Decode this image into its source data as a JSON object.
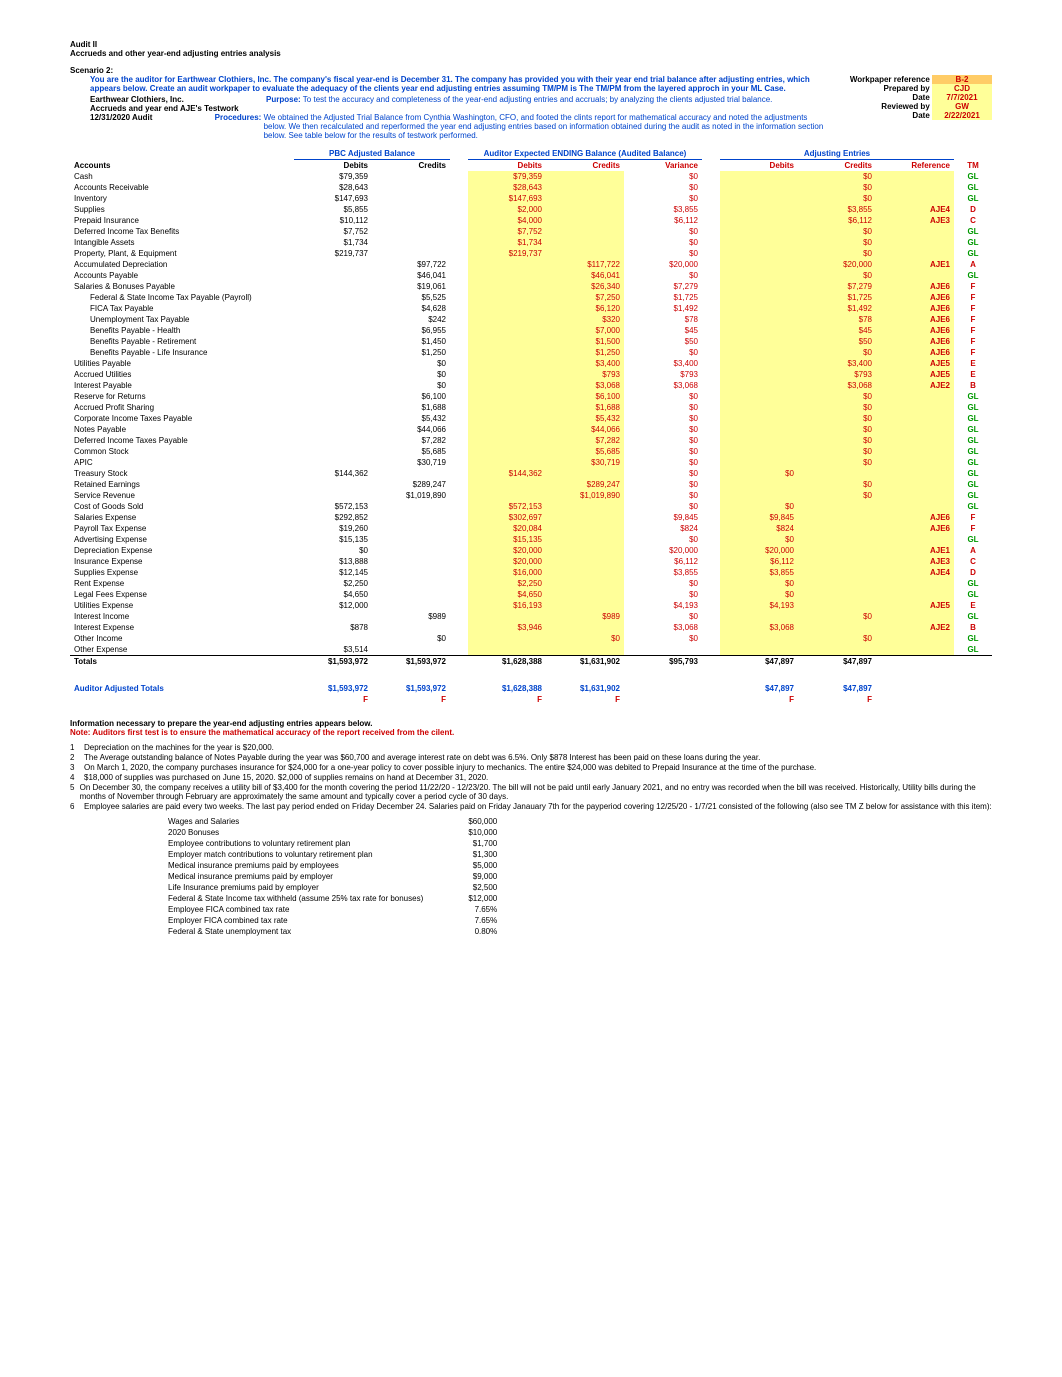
{
  "page_header": {
    "title": "Audit II",
    "subtitle": "Accrueds and other year-end adjusting entries analysis",
    "scenario": "Scenario 2:",
    "instruction": "You are the auditor for Earthwear Clothiers, Inc. The company's fiscal year-end is December 31. The company has provided you with their year end trial balance after adjusting entries, which appears below. Create an audit workpaper to evaluate the adequacy of the clients year end adjusting entries assuming TM/PM is The TM/PM from the layered approch in your ML Case."
  },
  "company": {
    "name": "Earthwear Clothiers, Inc.",
    "line2": "Accrueds and year end AJE's Testwork",
    "line3": "12/31/2020 Audit"
  },
  "purpose_label": "Purpose:",
  "purpose_text": "To test the accuracy and completeness of the year-end adjusting entries and accruals; by analyzing the clients adjusted trial balance.",
  "procedures_label": "Procedures:",
  "procedures_text": "We obtained the Adjusted Trial Balance from Cynthia Washington, CFO, and footed the clints report for mathematical accuracy and noted the adjustments below.   We then recalculated and reperformed the year end adjusting entries based on information obtained during the audit as noted in the information section below.  See table below for the results of testwork performed.",
  "workpaper": {
    "ref_label": "Workpaper reference",
    "ref": "B-2",
    "prep_label": "Prepared by",
    "prep": "CJD",
    "date1_label": "Date",
    "date1": "7/7/2021",
    "rev_label": "Reviewed by",
    "rev": "GW",
    "date2_label": "Date",
    "date2": "2/22/2021"
  },
  "columns": {
    "pbc": "PBC Adjusted Balance",
    "auditor": "Auditor Expected ENDING Balance (Audited Balance)",
    "aje": "Adjusting Entries",
    "accounts": "Accounts",
    "debits": "Debits",
    "credits": "Credits",
    "variance": "Variance",
    "reference": "Reference",
    "tm": "TM"
  },
  "rows": [
    {
      "a": "Cash",
      "pd": "$79,359",
      "pc": "",
      "ad": "$79,359",
      "ac": "",
      "v": "$0",
      "jd": "",
      "jc": "$0",
      "ref": "",
      "tm": "GL"
    },
    {
      "a": "Accounts Receivable",
      "pd": "$28,643",
      "pc": "",
      "ad": "$28,643",
      "ac": "",
      "v": "$0",
      "jd": "",
      "jc": "$0",
      "ref": "",
      "tm": "GL"
    },
    {
      "a": "Inventory",
      "pd": "$147,693",
      "pc": "",
      "ad": "$147,693",
      "ac": "",
      "v": "$0",
      "jd": "",
      "jc": "$0",
      "ref": "",
      "tm": "GL"
    },
    {
      "a": "Supplies",
      "pd": "$5,855",
      "pc": "",
      "ad": "$2,000",
      "ac": "",
      "v": "$3,855",
      "jd": "",
      "jc": "$3,855",
      "ref": "AJE4",
      "tm": "D"
    },
    {
      "a": "Prepaid Insurance",
      "pd": "$10,112",
      "pc": "",
      "ad": "$4,000",
      "ac": "",
      "v": "$6,112",
      "jd": "",
      "jc": "$6,112",
      "ref": "AJE3",
      "tm": "C"
    },
    {
      "a": "Deferred Income Tax Benefits",
      "pd": "$7,752",
      "pc": "",
      "ad": "$7,752",
      "ac": "",
      "v": "$0",
      "jd": "",
      "jc": "$0",
      "ref": "",
      "tm": "GL"
    },
    {
      "a": "Intangible Assets",
      "pd": "$1,734",
      "pc": "",
      "ad": "$1,734",
      "ac": "",
      "v": "$0",
      "jd": "",
      "jc": "$0",
      "ref": "",
      "tm": "GL"
    },
    {
      "a": "Property, Plant, & Equipment",
      "pd": "$219,737",
      "pc": "",
      "ad": "$219,737",
      "ac": "",
      "v": "$0",
      "jd": "",
      "jc": "$0",
      "ref": "",
      "tm": "GL"
    },
    {
      "a": "Accumulated Depreciation",
      "pd": "",
      "pc": "$97,722",
      "ad": "",
      "ac": "$117,722",
      "v": "$20,000",
      "jd": "",
      "jc": "$20,000",
      "ref": "AJE1",
      "tm": "A"
    },
    {
      "a": "Accounts Payable",
      "pd": "",
      "pc": "$46,041",
      "ad": "",
      "ac": "$46,041",
      "v": "$0",
      "jd": "",
      "jc": "$0",
      "ref": "",
      "tm": "GL"
    },
    {
      "a": "Salaries & Bonuses Payable",
      "pd": "",
      "pc": "$19,061",
      "ad": "",
      "ac": "$26,340",
      "v": "$7,279",
      "jd": "",
      "jc": "$7,279",
      "ref": "AJE6",
      "tm": "F"
    },
    {
      "a": "Federal & State Income Tax Payable (Payroll)",
      "pd": "",
      "pc": "$5,525",
      "ad": "",
      "ac": "$7,250",
      "v": "$1,725",
      "jd": "",
      "jc": "$1,725",
      "ref": "AJE6",
      "tm": "F",
      "indent": true
    },
    {
      "a": "FICA Tax Payable",
      "pd": "",
      "pc": "$4,628",
      "ad": "",
      "ac": "$6,120",
      "v": "$1,492",
      "jd": "",
      "jc": "$1,492",
      "ref": "AJE6",
      "tm": "F",
      "indent": true
    },
    {
      "a": "Unemployment Tax Payable",
      "pd": "",
      "pc": "$242",
      "ad": "",
      "ac": "$320",
      "v": "$78",
      "jd": "",
      "jc": "$78",
      "ref": "AJE6",
      "tm": "F",
      "indent": true
    },
    {
      "a": "Benefits Payable - Health",
      "pd": "",
      "pc": "$6,955",
      "ad": "",
      "ac": "$7,000",
      "v": "$45",
      "jd": "",
      "jc": "$45",
      "ref": "AJE6",
      "tm": "F",
      "indent": true
    },
    {
      "a": "Benefits Payable - Retirement",
      "pd": "",
      "pc": "$1,450",
      "ad": "",
      "ac": "$1,500",
      "v": "$50",
      "jd": "",
      "jc": "$50",
      "ref": "AJE6",
      "tm": "F",
      "indent": true
    },
    {
      "a": "Benefits Payable - Life Insurance",
      "pd": "",
      "pc": "$1,250",
      "ad": "",
      "ac": "$1,250",
      "v": "$0",
      "jd": "",
      "jc": "$0",
      "ref": "AJE6",
      "tm": "F",
      "indent": true
    },
    {
      "a": "Utilities Payable",
      "pd": "",
      "pc": "$0",
      "ad": "",
      "ac": "$3,400",
      "v": "$3,400",
      "jd": "",
      "jc": "$3,400",
      "ref": "AJE5",
      "tm": "E"
    },
    {
      "a": "Accrued Utilities",
      "pd": "",
      "pc": "$0",
      "ad": "",
      "ac": "$793",
      "v": "$793",
      "jd": "",
      "jc": "$793",
      "ref": "AJE5",
      "tm": "E"
    },
    {
      "a": "Interest Payable",
      "pd": "",
      "pc": "$0",
      "ad": "",
      "ac": "$3,068",
      "v": "$3,068",
      "jd": "",
      "jc": "$3,068",
      "ref": "AJE2",
      "tm": "B"
    },
    {
      "a": "Reserve for Returns",
      "pd": "",
      "pc": "$6,100",
      "ad": "",
      "ac": "$6,100",
      "v": "$0",
      "jd": "",
      "jc": "$0",
      "ref": "",
      "tm": "GL"
    },
    {
      "a": "Accrued Profit Sharing",
      "pd": "",
      "pc": "$1,688",
      "ad": "",
      "ac": "$1,688",
      "v": "$0",
      "jd": "",
      "jc": "$0",
      "ref": "",
      "tm": "GL"
    },
    {
      "a": "Corporate Income Taxes Payable",
      "pd": "",
      "pc": "$5,432",
      "ad": "",
      "ac": "$5,432",
      "v": "$0",
      "jd": "",
      "jc": "$0",
      "ref": "",
      "tm": "GL"
    },
    {
      "a": "Notes Payable",
      "pd": "",
      "pc": "$44,066",
      "ad": "",
      "ac": "$44,066",
      "v": "$0",
      "jd": "",
      "jc": "$0",
      "ref": "",
      "tm": "GL"
    },
    {
      "a": "Deferred Income Taxes Payable",
      "pd": "",
      "pc": "$7,282",
      "ad": "",
      "ac": "$7,282",
      "v": "$0",
      "jd": "",
      "jc": "$0",
      "ref": "",
      "tm": "GL"
    },
    {
      "a": "Common Stock",
      "pd": "",
      "pc": "$5,685",
      "ad": "",
      "ac": "$5,685",
      "v": "$0",
      "jd": "",
      "jc": "$0",
      "ref": "",
      "tm": "GL"
    },
    {
      "a": "APIC",
      "pd": "",
      "pc": "$30,719",
      "ad": "",
      "ac": "$30,719",
      "v": "$0",
      "jd": "",
      "jc": "$0",
      "ref": "",
      "tm": "GL"
    },
    {
      "a": "Treasury Stock",
      "pd": "$144,362",
      "pc": "",
      "ad": "$144,362",
      "ac": "",
      "v": "$0",
      "jd": "$0",
      "jc": "",
      "ref": "",
      "tm": "GL"
    },
    {
      "a": "Retained Earnings",
      "pd": "",
      "pc": "$289,247",
      "ad": "",
      "ac": "$289,247",
      "v": "$0",
      "jd": "",
      "jc": "$0",
      "ref": "",
      "tm": "GL"
    },
    {
      "a": "Service Revenue",
      "pd": "",
      "pc": "$1,019,890",
      "ad": "",
      "ac": "$1,019,890",
      "v": "$0",
      "jd": "",
      "jc": "$0",
      "ref": "",
      "tm": "GL"
    },
    {
      "a": "Cost of Goods Sold",
      "pd": "$572,153",
      "pc": "",
      "ad": "$572,153",
      "ac": "",
      "v": "$0",
      "jd": "$0",
      "jc": "",
      "ref": "",
      "tm": "GL"
    },
    {
      "a": "Salaries Expense",
      "pd": "$292,852",
      "pc": "",
      "ad": "$302,697",
      "ac": "",
      "v": "$9,845",
      "jd": "$9,845",
      "jc": "",
      "ref": "AJE6",
      "tm": "F"
    },
    {
      "a": "Payroll Tax Expense",
      "pd": "$19,260",
      "pc": "",
      "ad": "$20,084",
      "ac": "",
      "v": "$824",
      "jd": "$824",
      "jc": "",
      "ref": "AJE6",
      "tm": "F"
    },
    {
      "a": "Advertising Expense",
      "pd": "$15,135",
      "pc": "",
      "ad": "$15,135",
      "ac": "",
      "v": "$0",
      "jd": "$0",
      "jc": "",
      "ref": "",
      "tm": "GL"
    },
    {
      "a": "Depreciation Expense",
      "pd": "$0",
      "pc": "",
      "ad": "$20,000",
      "ac": "",
      "v": "$20,000",
      "jd": "$20,000",
      "jc": "",
      "ref": "AJE1",
      "tm": "A"
    },
    {
      "a": "Insurance Expense",
      "pd": "$13,888",
      "pc": "",
      "ad": "$20,000",
      "ac": "",
      "v": "$6,112",
      "jd": "$6,112",
      "jc": "",
      "ref": "AJE3",
      "tm": "C"
    },
    {
      "a": "Supplies Expense",
      "pd": "$12,145",
      "pc": "",
      "ad": "$16,000",
      "ac": "",
      "v": "$3,855",
      "jd": "$3,855",
      "jc": "",
      "ref": "AJE4",
      "tm": "D"
    },
    {
      "a": "Rent Expense",
      "pd": "$2,250",
      "pc": "",
      "ad": "$2,250",
      "ac": "",
      "v": "$0",
      "jd": "$0",
      "jc": "",
      "ref": "",
      "tm": "GL"
    },
    {
      "a": "Legal Fees Expense",
      "pd": "$4,650",
      "pc": "",
      "ad": "$4,650",
      "ac": "",
      "v": "$0",
      "jd": "$0",
      "jc": "",
      "ref": "",
      "tm": "GL"
    },
    {
      "a": "Utilities Expense",
      "pd": "$12,000",
      "pc": "",
      "ad": "$16,193",
      "ac": "",
      "v": "$4,193",
      "jd": "$4,193",
      "jc": "",
      "ref": "AJE5",
      "tm": "E"
    },
    {
      "a": "Interest Income",
      "pd": "",
      "pc": "$989",
      "ad": "",
      "ac": "$989",
      "v": "$0",
      "jd": "",
      "jc": "$0",
      "ref": "",
      "tm": "GL"
    },
    {
      "a": "Interest Expense",
      "pd": "$878",
      "pc": "",
      "ad": "$3,946",
      "ac": "",
      "v": "$3,068",
      "jd": "$3,068",
      "jc": "",
      "ref": "AJE2",
      "tm": "B"
    },
    {
      "a": "Other Income",
      "pd": "",
      "pc": "$0",
      "ad": "",
      "ac": "$0",
      "v": "$0",
      "jd": "",
      "jc": "$0",
      "ref": "",
      "tm": "GL"
    },
    {
      "a": "Other Expense",
      "pd": "$3,514",
      "pc": "",
      "ad": "",
      "ac": "",
      "v": "",
      "jd": "",
      "jc": "",
      "ref": "",
      "tm": "GL"
    }
  ],
  "totals": {
    "label": "Totals",
    "pd": "$1,593,972",
    "pc": "$1,593,972",
    "ad": "$1,628,388",
    "ac": "$1,631,902",
    "v": "$95,793",
    "jd": "$47,897",
    "jc": "$47,897"
  },
  "auditor_totals": {
    "label": "Auditor Adjusted Totals",
    "pd": "$1,593,972",
    "pc": "$1,593,972",
    "ad": "$1,628,388",
    "ac": "$1,631,902",
    "jd": "$47,897",
    "jc": "$47,897",
    "f": "F"
  },
  "info_header": "Information necessary to prepare the year-end adjusting entries appears below.",
  "info_note": "Note: Auditors first test is to ensure the mathematical accuracy of the report received from the cilent.",
  "info_items": [
    {
      "n": "1",
      "t": "Depreciation on the machines for the year is $20,000."
    },
    {
      "n": "2",
      "t": "The Average outstanding balance of Notes Payable during the year was $60,700 and average interest rate on debt was 6.5%.  Only $878  Interest has been paid on these loans during the year."
    },
    {
      "n": "3",
      "t": "On March 1, 2020, the company purchases insurance for $24,000 for a one-year policy to cover possible injury to mechanics. The entire $24,000 was debited to Prepaid Insurance at the time of the purchase."
    },
    {
      "n": "4",
      "t": "$18,000 of supplies was purchased on June 15, 2020. $2,000 of supplies remains on hand at December 31, 2020."
    },
    {
      "n": "5",
      "t": "On December 30, the company receives a utility bill of $3,400 for the month covering the period 11/22/20 - 12/23/20. The bill will not be paid until early January 2021, and no entry was recorded when the bill was received.  Historically, Utility bills during the months of November through February are approximately the same amount and typically cover a period cycle of 30 days."
    },
    {
      "n": "6",
      "t": "Employee salaries are paid every two weeks. The last pay period ended on Friday December 24. Salaries paid on Friday Janauary 7th for the payperiod covering 12/25/20 - 1/7/21 consisted of the following (also see TM Z below for assistance with this item):"
    }
  ],
  "wages": [
    {
      "l": "Wages and Salaries",
      "v": "$60,000"
    },
    {
      "l": "2020 Bonuses",
      "v": "$10,000"
    },
    {
      "l": "Employee contributions to voluntary retirement plan",
      "v": "$1,700"
    },
    {
      "l": "Employer match contributions to voluntary retirement plan",
      "v": "$1,300"
    },
    {
      "l": "Medical insurance premiums paid by employees",
      "v": "$5,000"
    },
    {
      "l": "Medical insurance premiums paid by employer",
      "v": "$9,000"
    },
    {
      "l": "Life Insurance premiums paid by employer",
      "v": "$2,500"
    },
    {
      "l": "Federal & State Income tax withheld (assume 25% tax rate for bonuses)",
      "v": "$12,000"
    },
    {
      "l": "Employee FICA combined tax rate",
      "v": "7.65%"
    },
    {
      "l": "Employer FICA combined tax rate",
      "v": "7.65%"
    },
    {
      "l": "Federal & State unemployment tax",
      "v": "0.80%"
    }
  ]
}
